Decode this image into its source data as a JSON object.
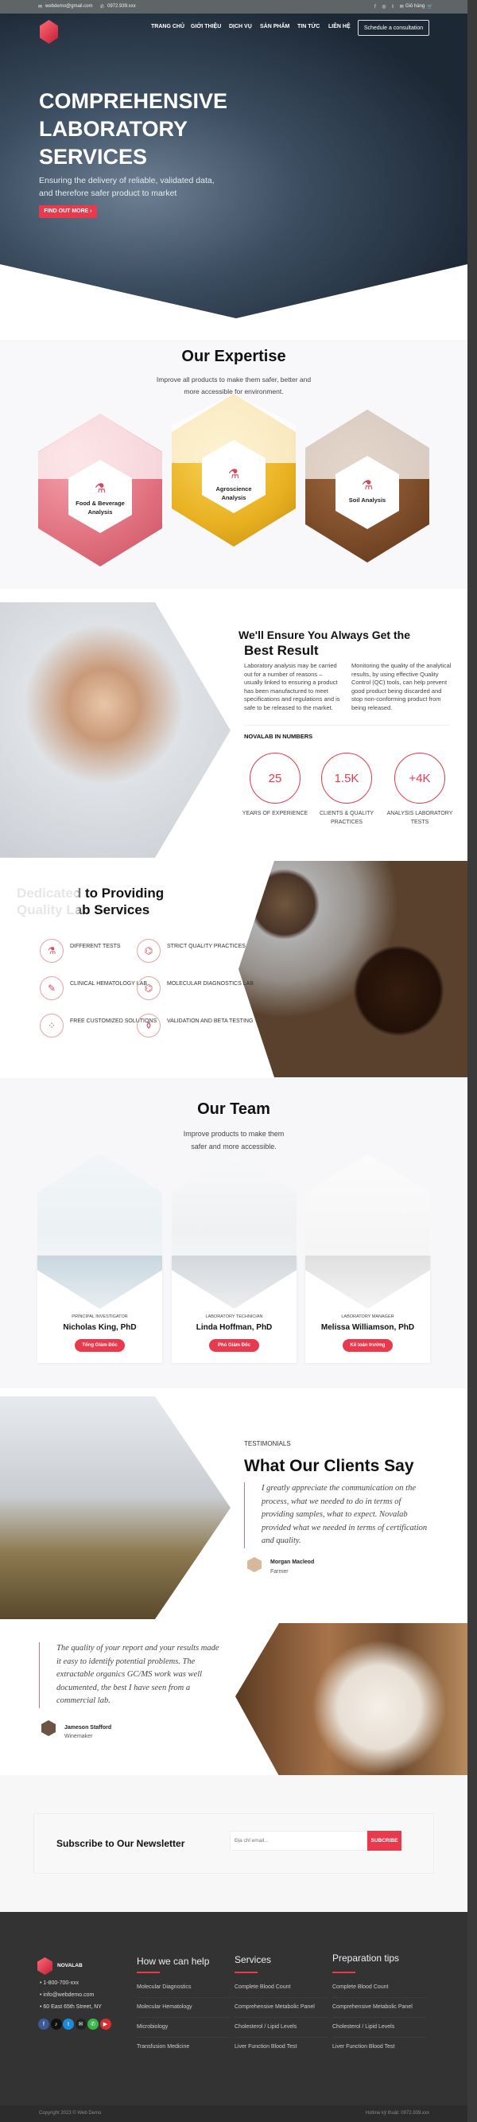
{
  "topbar": {
    "email": "webdemo@gmail.com",
    "phone": "0972.939.xxx",
    "social_icons": [
      "facebook-icon",
      "instagram-icon",
      "twitter-icon",
      "email-icon"
    ],
    "cart_label": "Giỏ hàng"
  },
  "brand": {
    "name": "NOVALAB",
    "accent": "#e8394d"
  },
  "nav": {
    "items": [
      "TRANG CHỦ",
      "GIỚI THIỆU",
      "DỊCH VỤ",
      "SẢN PHẨM",
      "TIN TỨC",
      "LIÊN HỆ"
    ],
    "cta": "Schedule a consultation"
  },
  "hero": {
    "title_lines": [
      "COMPREHENSIVE",
      "LABORATORY",
      "SERVICES"
    ],
    "subtitle_lines": [
      "Ensuring the delivery of reliable, validated data,",
      "and therefore safer product to market"
    ],
    "button": "FIND OUT MORE ›"
  },
  "expertise": {
    "title": "Our Expertise",
    "subtitle_lines": [
      "Improve all products to make them safer, better and",
      "more accessible for environment."
    ],
    "items": [
      {
        "label_lines": [
          "Food & Beverage",
          "Analysis"
        ]
      },
      {
        "label_lines": [
          "Agroscience",
          "Analysis"
        ]
      },
      {
        "label_lines": [
          "Soil Analysis"
        ]
      }
    ]
  },
  "about": {
    "heading": "We'll Ensure You Always Get the",
    "heading2": "Best Result",
    "para1": "Laboratory analysis may be carried out for a number of reasons – usually linked to ensuring a product has been manufactured to meet specifications and regulations and is safe to be released to the market.",
    "para2": "Monitoring the quality of the analytical results, by using effective Quality Control (QC) tools, can help prevent good product being discarded and stop non-conforming product from being released.",
    "numbers_title": "NOVALAB IN NUMBERS",
    "stats": [
      {
        "value": "25",
        "label": "YEARS OF EXPERIENCE"
      },
      {
        "value": "1.5K",
        "label": "CLIENTS & QUALITY PRACTICES"
      },
      {
        "value": "+4K",
        "label": "ANALYSIS LABORATORY TESTS"
      }
    ]
  },
  "dedicated": {
    "title_lines": [
      "Dedicated to Providing",
      "Quality Lab Services"
    ],
    "features": [
      {
        "label": "DIFFERENT TESTS",
        "icon": "test-tube-icon"
      },
      {
        "label": "STRICT QUALITY PRACTICES",
        "icon": "molecule-icon"
      },
      {
        "label": "CLINICAL HEMATOLOGY LAB",
        "icon": "pipette-icon"
      },
      {
        "label": "MOLECULAR DIAGNOSTICS LAB",
        "icon": "molecule-icon"
      },
      {
        "label": "FREE CUSTOMIZED SOLUTIONS",
        "icon": "pills-icon"
      },
      {
        "label": "VALIDATION AND BETA TESTING",
        "icon": "lab-equipment-icon"
      }
    ]
  },
  "team": {
    "title": "Our Team",
    "subtitle_lines": [
      "Improve products to make them",
      "safer and more accessible."
    ],
    "members": [
      {
        "role": "PRINCIPAL INVESTIGATOR",
        "name": "Nicholas King, PhD",
        "badge": "Tổng Giám Đốc"
      },
      {
        "role": "LABORATORY TECHNICIAN",
        "name": "Linda Hoffman, PhD",
        "badge": "Phó Giám Đốc"
      },
      {
        "role": "LABORATORY MANAGER",
        "name": "Melissa Williamson, PhD",
        "badge": "Kế toán trưởng"
      }
    ]
  },
  "testimonials": {
    "eyebrow": "TESTIMONIALS",
    "title": "What Our Clients Say",
    "items": [
      {
        "quote": "I greatly appreciate the communication on the process, what we needed to do in terms of providing samples, what to expect. Novalab provided what we needed in terms of certification and quality.",
        "name": "Morgan Macleod",
        "role": "Farmer"
      },
      {
        "quote": "The quality of your report and your results made it easy to identify potential problems. The extractable organics GC/MS work was well documented, the best I have seen from a commercial lab.",
        "name": "Jameson Stafford",
        "role": "Winemaker"
      }
    ]
  },
  "newsletter": {
    "title": "Subscribe to Our Newsletter",
    "placeholder": "Địa chỉ email...",
    "button": "SUBCRIBE"
  },
  "footer": {
    "contacts": [
      "1-800-700-xxx",
      "info@webdemo.com",
      "60 East 65th Street, NY"
    ],
    "socials": [
      {
        "icon": "facebook-icon",
        "color": "#3b5998",
        "glyph": "f"
      },
      {
        "icon": "tiktok-icon",
        "color": "#111111",
        "glyph": "♪"
      },
      {
        "icon": "twitter-icon",
        "color": "#1d8cd8",
        "glyph": "t"
      },
      {
        "icon": "email-icon",
        "color": "#222222",
        "glyph": "✉"
      },
      {
        "icon": "phone-icon",
        "color": "#3bb54a",
        "glyph": "✆"
      },
      {
        "icon": "youtube-icon",
        "color": "#d62e2e",
        "glyph": "▶"
      }
    ],
    "columns": [
      {
        "title": "How we can help",
        "links": [
          "Molecular Diagnostics",
          "Molecular Hematology",
          "Microbiology",
          "Transfusion Medicine"
        ]
      },
      {
        "title": "Services",
        "links": [
          "Complete Blood Count",
          "Comprehensive Metabolic Panel",
          "Cholesterol / Lipid Levels",
          "Liver Function Blood Test"
        ]
      },
      {
        "title": "Preparation tips",
        "links": [
          "Complete Blood Count",
          "Comprehensive Metabolic Panel",
          "Cholesterol / Lipid Levels",
          "Liver Function Blood Test"
        ]
      }
    ],
    "copyright": "Copyright 2023 © Web Demo",
    "hotline": "Hotline kỹ thuật: 0972.939.xxx"
  }
}
